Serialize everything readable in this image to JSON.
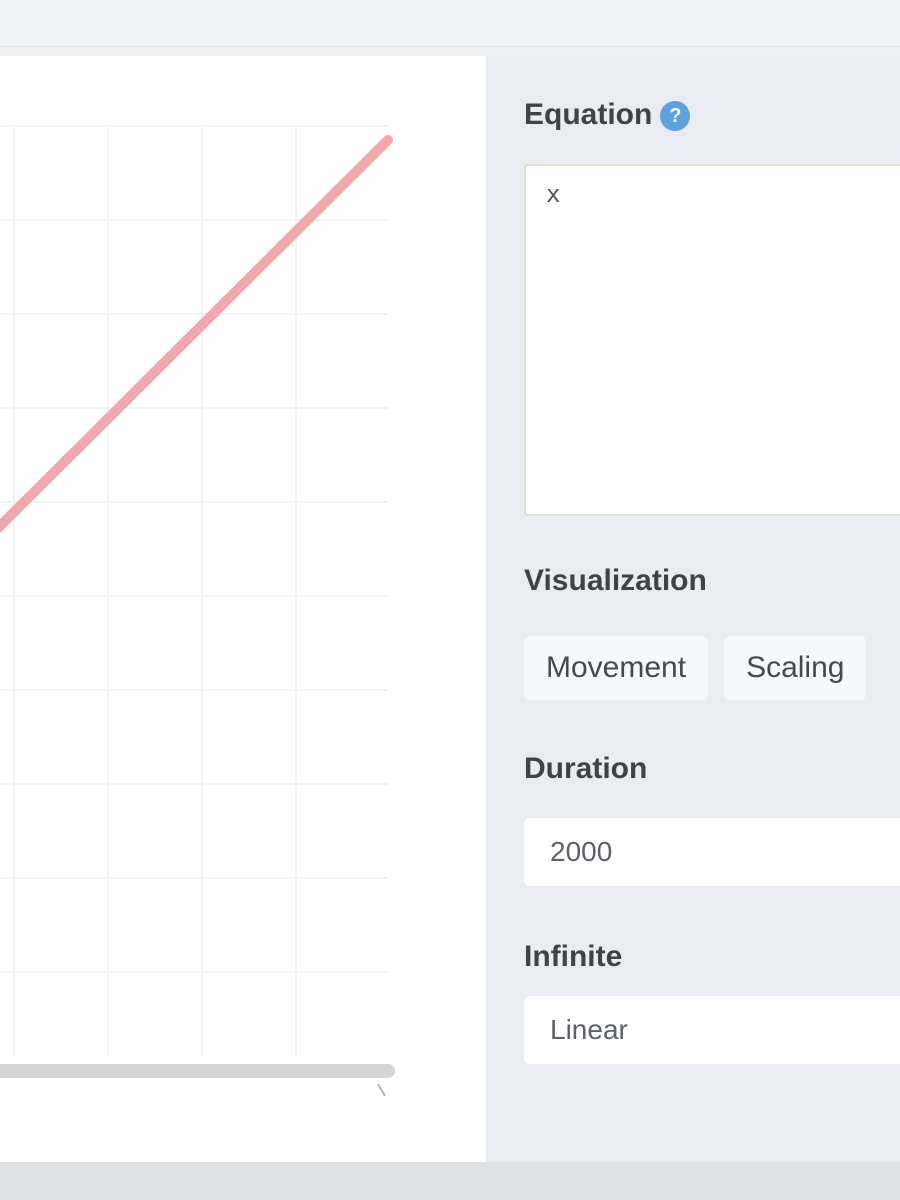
{
  "canvas": {
    "curve_color": "#f2a7aa",
    "grid_color": "#f3f4f5",
    "axis_color": "#d6d6d6"
  },
  "side_panel": {
    "equation": {
      "label": "Equation",
      "help_icon": "help-icon",
      "value": "x"
    },
    "visualization": {
      "label": "Visualization",
      "options": [
        "Movement",
        "Scaling"
      ]
    },
    "duration": {
      "label": "Duration",
      "value": "2000"
    },
    "easing": {
      "label": "Infinite",
      "value": "Linear"
    }
  }
}
